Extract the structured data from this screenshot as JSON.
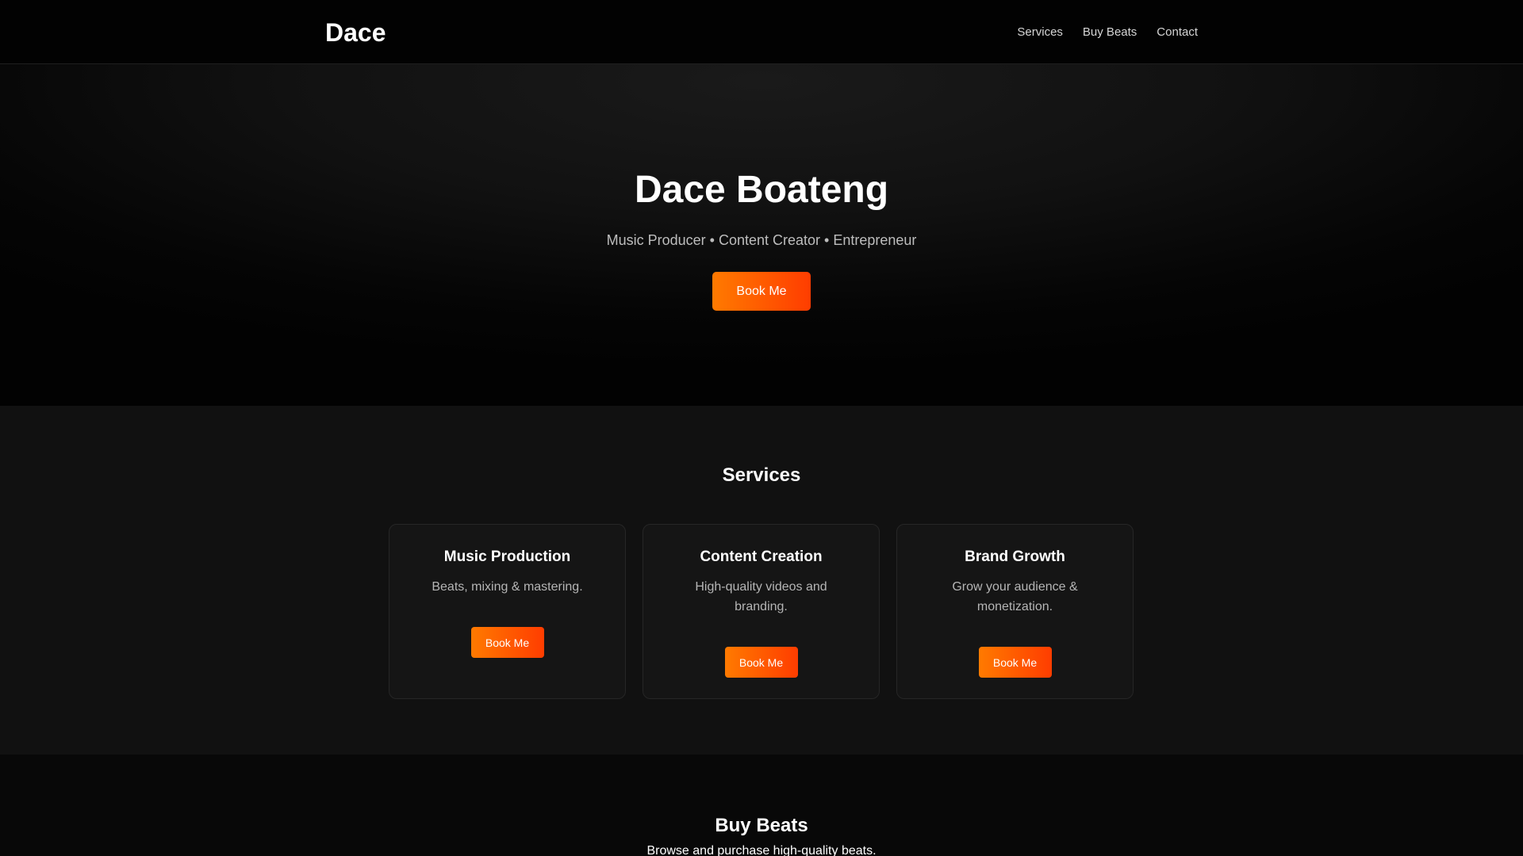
{
  "header": {
    "logo": "Dace",
    "nav": [
      "Services",
      "Buy Beats",
      "Contact"
    ]
  },
  "hero": {
    "title": "Dace Boateng",
    "subtitle": "Music Producer • Content Creator • Entrepreneur",
    "button_label": "Book Me"
  },
  "services": {
    "title": "Services",
    "cards": [
      {
        "title": "Music Production",
        "description": "Beats, mixing & mastering.",
        "button_label": "Book Me"
      },
      {
        "title": "Content Creation",
        "description": "High-quality videos and branding.",
        "button_label": "Book Me"
      },
      {
        "title": "Brand Growth",
        "description": "Grow your audience & monetization.",
        "button_label": "Book Me"
      }
    ]
  },
  "beats": {
    "title": "Buy Beats",
    "description": "Browse and purchase high-quality beats."
  },
  "colors": {
    "accent_start": "#ff7a00",
    "accent_end": "#ff3d00",
    "background": "#000000"
  }
}
